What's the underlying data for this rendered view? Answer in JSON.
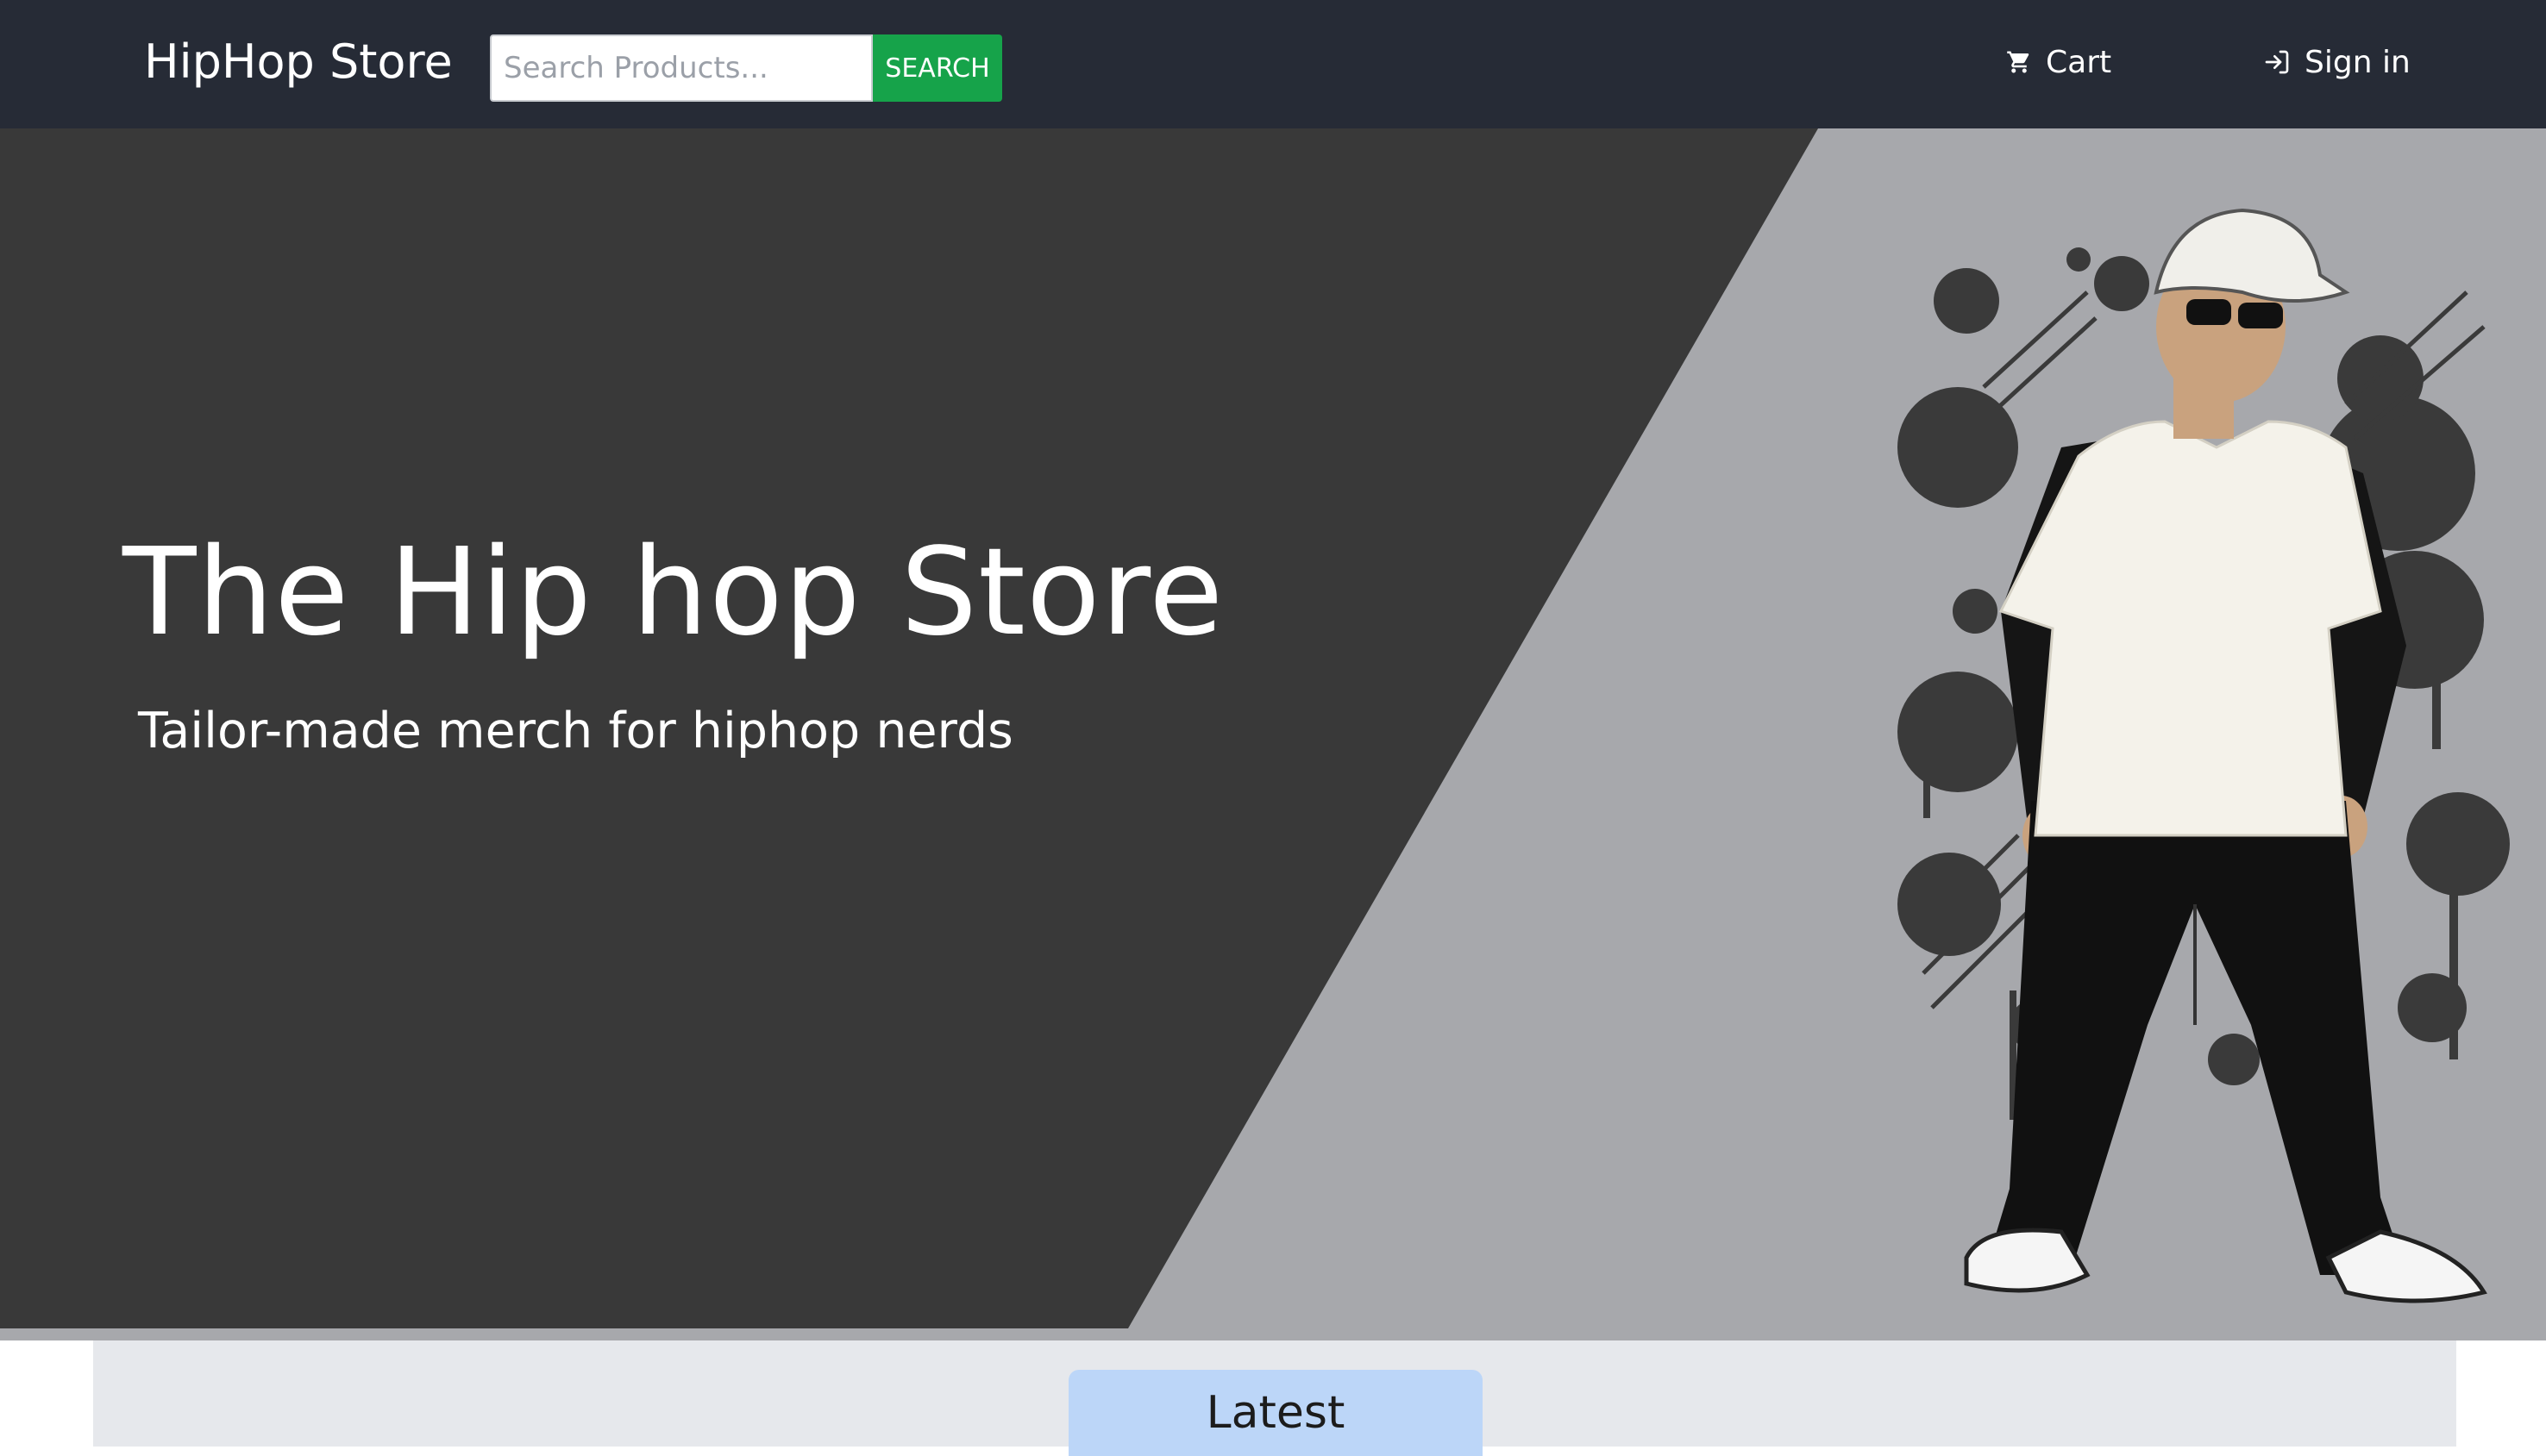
{
  "navbar": {
    "brand": "HipHop Store",
    "search": {
      "placeholder": "Search Products...",
      "value": "",
      "button_label": "SEARCH"
    },
    "cart_label": "Cart",
    "signin_label": "Sign in",
    "icons": {
      "cart": "cart-icon",
      "signin": "sign-in-icon"
    },
    "colors": {
      "background": "#262b36",
      "search_button": "#16a34a"
    }
  },
  "hero": {
    "title": "The Hip hop Store",
    "subtitle": "Tailor-made merch for  hiphop nerds",
    "colors": {
      "dark_panel": "#393939",
      "light_panel": "#a7a8ac"
    }
  },
  "latest": {
    "tab_label": "Latest",
    "colors": {
      "tab": "#bcd6f8",
      "section": "#e6e8ec"
    }
  }
}
